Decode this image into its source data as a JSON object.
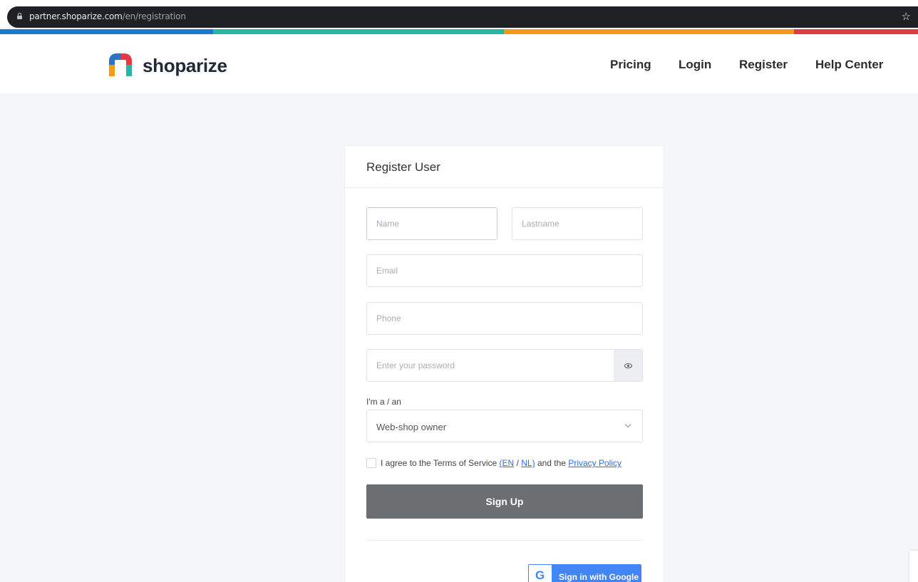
{
  "browser": {
    "url_host": "partner.shoparize.com",
    "url_path": "/en/registration"
  },
  "colors": {
    "strip": [
      "#1f78c8",
      "#2bb3a3",
      "#f39c12",
      "#e63946"
    ],
    "signup_button": "#6c6f72",
    "link": "#2f6fd6",
    "google_blue": "#4285f4"
  },
  "header": {
    "brand": "shoparize",
    "nav": [
      "Pricing",
      "Login",
      "Register",
      "Help Center"
    ]
  },
  "form": {
    "title": "Register User",
    "name_placeholder": "Name",
    "lastname_placeholder": "Lastname",
    "email_placeholder": "Email",
    "phone_placeholder": "Phone",
    "password_placeholder": "Enter your password",
    "role_label": "I'm a / an",
    "role_value": "Web-shop owner",
    "terms_prefix": "I agree to the Terms of Service",
    "terms_open": "(",
    "terms_en": "EN",
    "terms_sep": "/",
    "terms_nl": "NL)",
    "terms_mid": "and the",
    "privacy_link": "Privacy Policy",
    "signup_label": "Sign Up",
    "google_label": "Sign in with Google",
    "google_glyph": "G"
  }
}
